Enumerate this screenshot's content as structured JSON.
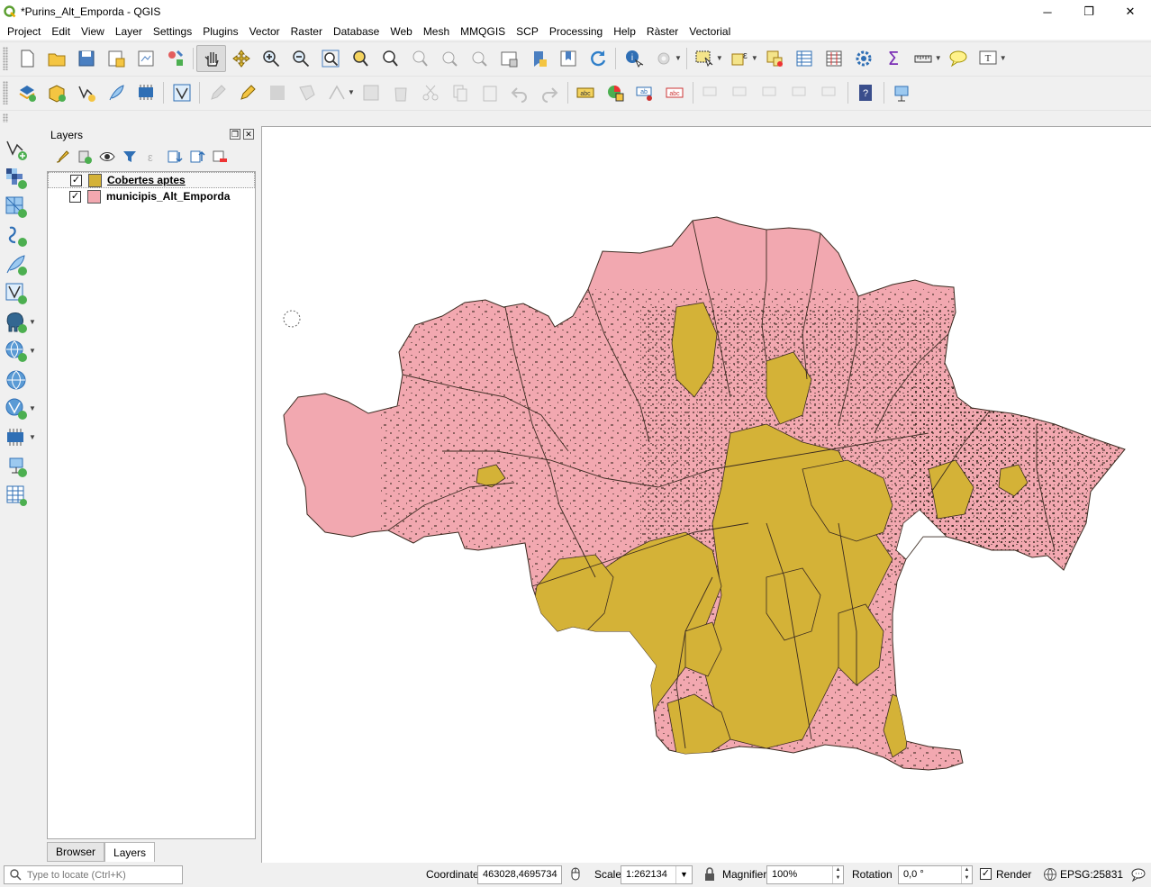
{
  "window": {
    "title": "*Purins_Alt_Emporda - QGIS",
    "minimize": "─",
    "maximize": "❐",
    "close": "✕"
  },
  "menu": [
    "Project",
    "Edit",
    "View",
    "Layer",
    "Settings",
    "Plugins",
    "Vector",
    "Raster",
    "Database",
    "Web",
    "Mesh",
    "MMQGIS",
    "SCP",
    "Processing",
    "Help",
    "Ràster",
    "Vectorial"
  ],
  "layers_panel": {
    "title": "Layers",
    "layers": [
      {
        "name": "Cobertes aptes",
        "checked": "✓",
        "color": "#d4b237"
      },
      {
        "name": "municipis_Alt_Emporda",
        "checked": "✓",
        "color": "#f2a8b0"
      }
    ],
    "tabs": {
      "browser": "Browser",
      "layers": "Layers"
    }
  },
  "map": {
    "municipis_fill": "#f2a8b0",
    "cobertes_fill": "#d4b237",
    "outline": "#3a2a20"
  },
  "status": {
    "locate_placeholder": "Type to locate (Ctrl+K)",
    "coordinate_label": "Coordinate",
    "coordinate_value": "463028,4695734",
    "scale_label": "Scale",
    "scale_value": "1:262134",
    "magnifier_label": "Magnifier",
    "magnifier_value": "100%",
    "rotation_label": "Rotation",
    "rotation_value": "0,0 °",
    "render_label": "Render",
    "render_checked": "✓",
    "crs": "EPSG:25831"
  }
}
